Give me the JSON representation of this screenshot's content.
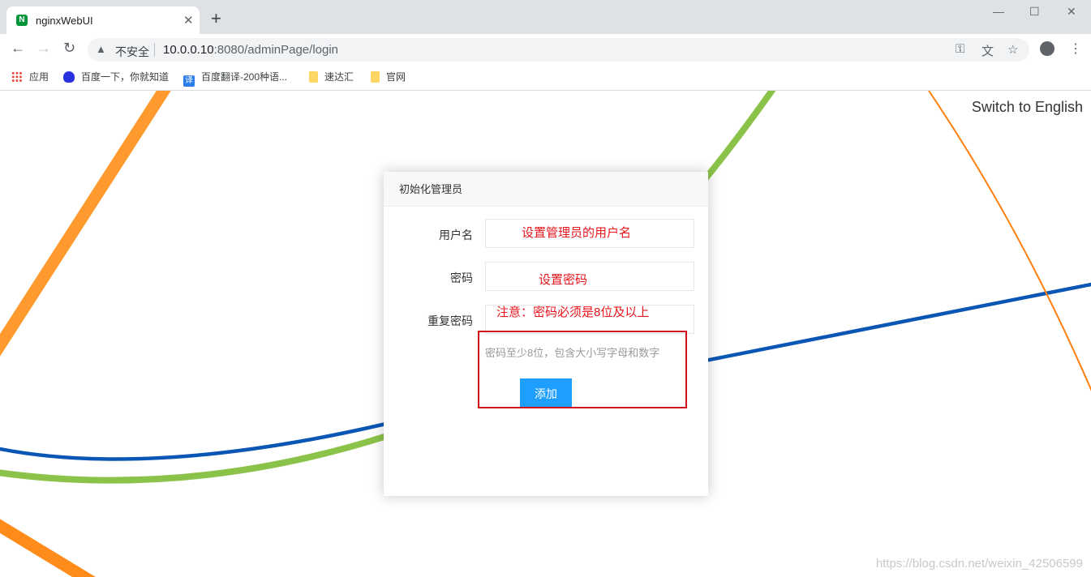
{
  "browser": {
    "tab_title": "nginxWebUI",
    "tab_favicon_letter": "N",
    "close_glyph": "✕",
    "new_tab_glyph": "+",
    "window": {
      "minimize": "—",
      "maximize": "☐",
      "close": "✕"
    },
    "nav": {
      "back": "←",
      "forward": "→",
      "reload": "↻"
    },
    "security_label": "不安全",
    "url_host": "10.0.0.10",
    "url_rest": ":8080/adminPage/login",
    "omnibox_icons": [
      "key-icon",
      "translate-icon",
      "star-icon"
    ],
    "bookmarks": [
      {
        "label": "应用",
        "icon": "apps-icon"
      },
      {
        "label": "百度一下，你就知道",
        "icon": "baidu-icon"
      },
      {
        "label": "百度翻译-200种语...",
        "icon": "fanyi-icon"
      },
      {
        "label": "速达汇",
        "icon": "folder-icon"
      },
      {
        "label": "官网",
        "icon": "folder-icon"
      }
    ],
    "fanyi_glyph": "译"
  },
  "page": {
    "switch_language": "Switch to English",
    "dialog": {
      "title": "初始化管理员",
      "username_label": "用户名",
      "password_label": "密码",
      "repeat_password_label": "重复密码",
      "password_hint": "密码至少8位，包含大小写字母和数字",
      "add_button": "添加"
    },
    "annotations": {
      "username": "设置管理员的用户名",
      "password": "设置密码",
      "note": "注意：密码必须是8位及以上"
    },
    "watermark": "https://blog.csdn.net/weixin_42506599"
  },
  "colors": {
    "accent_button": "#1e9fff",
    "annotation_red": "#e8141b",
    "line_orange": "#ff8c1a",
    "line_green": "#8bc34a",
    "line_blue": "#0a56b4"
  }
}
